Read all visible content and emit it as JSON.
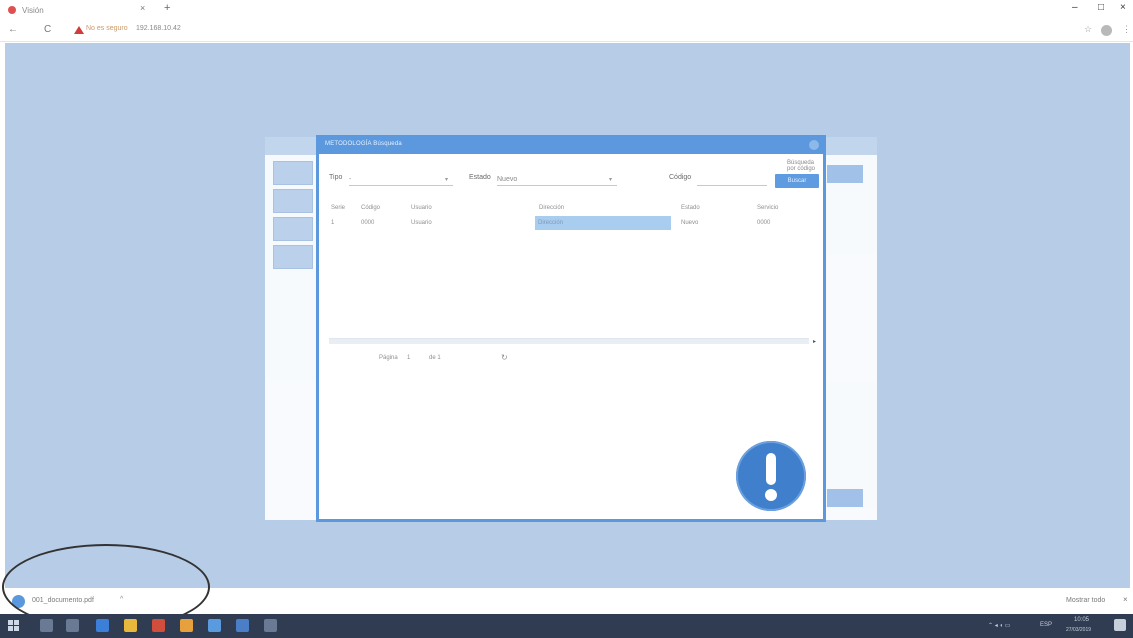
{
  "browser": {
    "tab_title": "Visión",
    "new_tab": "+",
    "minimize": "–",
    "maximize": "□",
    "close": "×",
    "back": "←",
    "reload": "C",
    "security_label": "No es seguro",
    "url": "192.168.10.42"
  },
  "dialog": {
    "title": "METODOLOGÍA Búsqueda",
    "corner_hint": "Búsqueda por código",
    "filters": {
      "tipo_label": "Tipo",
      "tipo_value": "-",
      "estado_label": "Estado",
      "estado_value": "Nuevo",
      "codigo_label": "Código",
      "codigo_value": ""
    },
    "search_button": "Buscar",
    "table": {
      "headers": [
        "Serie",
        "Código",
        "Usuario",
        "Dirección",
        "Estado",
        "Servicio"
      ],
      "rows": [
        [
          "1",
          "0000",
          "Usuario",
          "Dirección",
          "Nuevo",
          "0000"
        ]
      ]
    },
    "pager": {
      "page_label": "Página",
      "page_value": "1",
      "of_label": "de 1",
      "refresh": "↻"
    }
  },
  "download": {
    "file": "001_documento.pdf",
    "caret": "^",
    "show_all": "Mostrar todo",
    "close": "×"
  },
  "taskbar": {
    "time": "10:05",
    "date": "27/03/2019",
    "lang": "ESP"
  },
  "colors": {
    "accent": "#5b98dd",
    "page_bg": "#b7cce6",
    "info_badge": "#3f7fcc",
    "taskbar": "#2f3c52"
  }
}
